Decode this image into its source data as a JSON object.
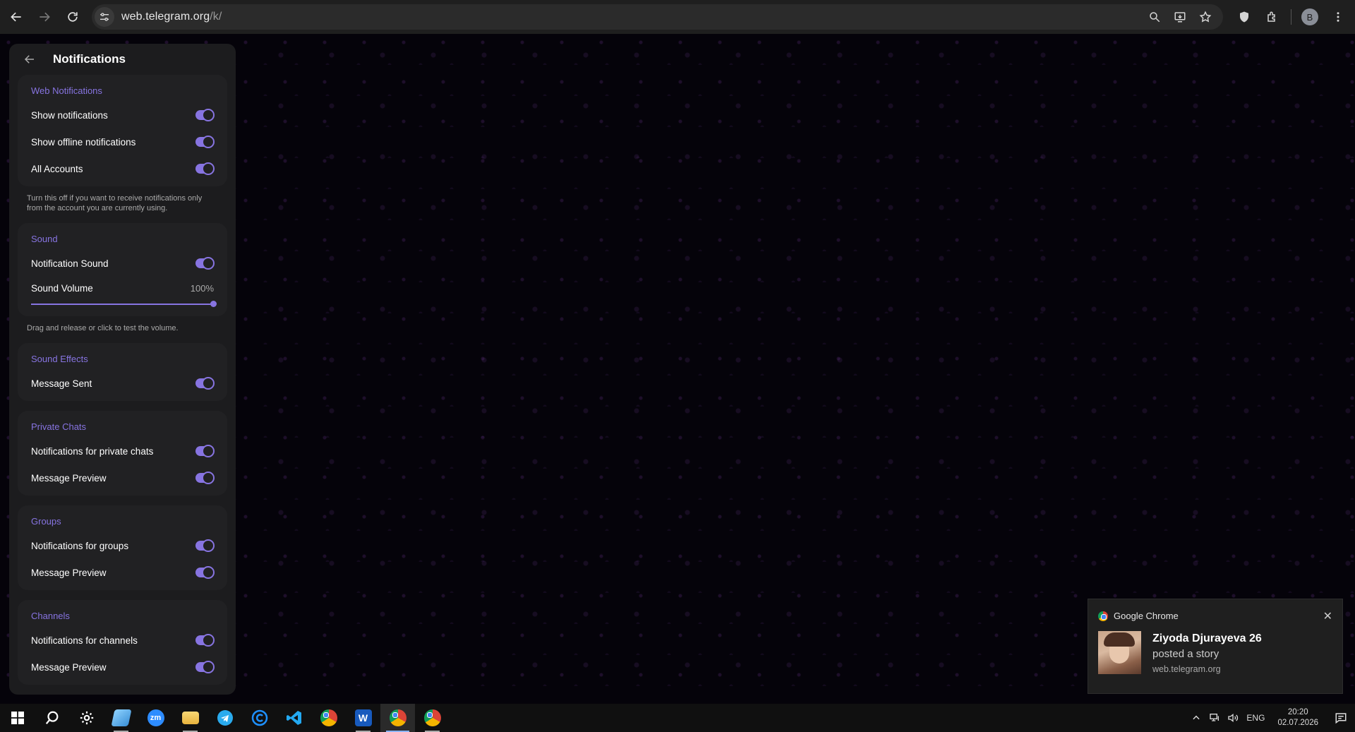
{
  "browser": {
    "url_host": "web.telegram.org",
    "url_path": "/k/",
    "profile_initial": "B"
  },
  "panel": {
    "title": "Notifications",
    "sections": {
      "web": {
        "title": "Web Notifications",
        "show_notifications": "Show notifications",
        "show_offline": "Show offline notifications",
        "all_accounts": "All Accounts",
        "hint": "Turn this off if you want to receive notifications only from the account you are currently using."
      },
      "sound": {
        "title": "Sound",
        "notification_sound": "Notification Sound",
        "volume_label": "Sound Volume",
        "volume_value": "100%",
        "volume_fraction": 1.0,
        "hint": "Drag and release or click to test the volume."
      },
      "effects": {
        "title": "Sound Effects",
        "message_sent": "Message Sent"
      },
      "private": {
        "title": "Private Chats",
        "notifications": "Notifications for private chats",
        "preview": "Message Preview"
      },
      "groups": {
        "title": "Groups",
        "notifications": "Notifications for groups",
        "preview": "Message Preview"
      },
      "channels": {
        "title": "Channels",
        "notifications": "Notifications for channels",
        "preview": "Message Preview"
      }
    },
    "accent_color": "#8774e1"
  },
  "toast": {
    "app": "Google Chrome",
    "sender": "Ziyoda Djurayeva 26",
    "message": "posted a story",
    "site": "web.telegram.org"
  },
  "taskbar": {
    "apps": [
      "windows-start",
      "search",
      "settings",
      "notepad",
      "zoom",
      "file-explorer",
      "telegram",
      "ccleaner",
      "vscode",
      "chrome",
      "word",
      "chrome-profile-b",
      "chrome-profile-m"
    ],
    "zoom_label": "zm",
    "word_label": "W",
    "language": "ENG",
    "time": "20:20",
    "date": "02.07.2026"
  }
}
